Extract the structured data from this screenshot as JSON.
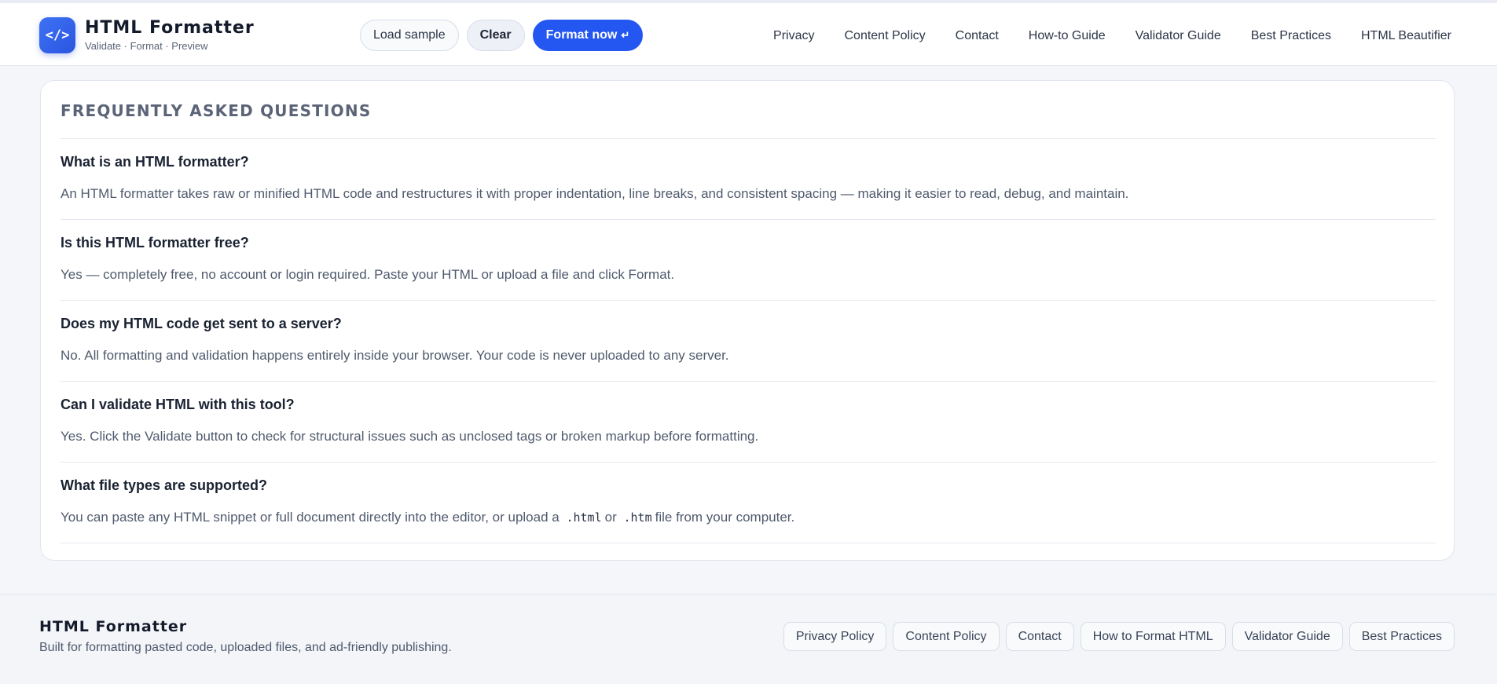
{
  "brand": {
    "logo_glyph": "</>",
    "title": "HTML Formatter",
    "subtitle": "Validate · Format · Preview"
  },
  "toolbar": {
    "load_sample_label": "Load sample",
    "clear_label": "Clear",
    "format_label": "Format now",
    "format_enter_glyph": "↵"
  },
  "nav": {
    "items": [
      {
        "label": "Privacy"
      },
      {
        "label": "Content Policy"
      },
      {
        "label": "Contact"
      },
      {
        "label": "How-to Guide"
      },
      {
        "label": "Validator Guide"
      },
      {
        "label": "Best Practices"
      },
      {
        "label": "HTML Beautifier"
      }
    ]
  },
  "faq": {
    "heading": "FREQUENTLY ASKED QUESTIONS",
    "items": [
      {
        "question": "What is an HTML formatter?",
        "answer": "An HTML formatter takes raw or minified HTML code and restructures it with proper indentation, line breaks, and consistent spacing — making it easier to read, debug, and maintain."
      },
      {
        "question": "Is this HTML formatter free?",
        "answer": "Yes — completely free, no account or login required. Paste your HTML or upload a file and click Format."
      },
      {
        "question": "Does my HTML code get sent to a server?",
        "answer": "No. All formatting and validation happens entirely inside your browser. Your code is never uploaded to any server."
      },
      {
        "question": "Can I validate HTML with this tool?",
        "answer": "Yes. Click the Validate button to check for structural issues such as unclosed tags or broken markup before formatting."
      },
      {
        "question": "What file types are supported?",
        "answer_parts": {
          "before": "You can paste any HTML snippet or full document directly into the editor, or upload a",
          "code1": ".html",
          "middle": "or",
          "code2": ".htm",
          "after": "file from your computer."
        }
      }
    ]
  },
  "footer": {
    "brand": "HTML Formatter",
    "tagline": "Built for formatting pasted code, uploaded files, and ad-friendly publishing.",
    "links": [
      {
        "label": "Privacy Policy"
      },
      {
        "label": "Content Policy"
      },
      {
        "label": "Contact"
      },
      {
        "label": "How to Format HTML"
      },
      {
        "label": "Validator Guide"
      },
      {
        "label": "Best Practices"
      }
    ]
  },
  "colors": {
    "accent": "#2457f2",
    "background": "#f4f6fa",
    "card": "#ffffff"
  }
}
